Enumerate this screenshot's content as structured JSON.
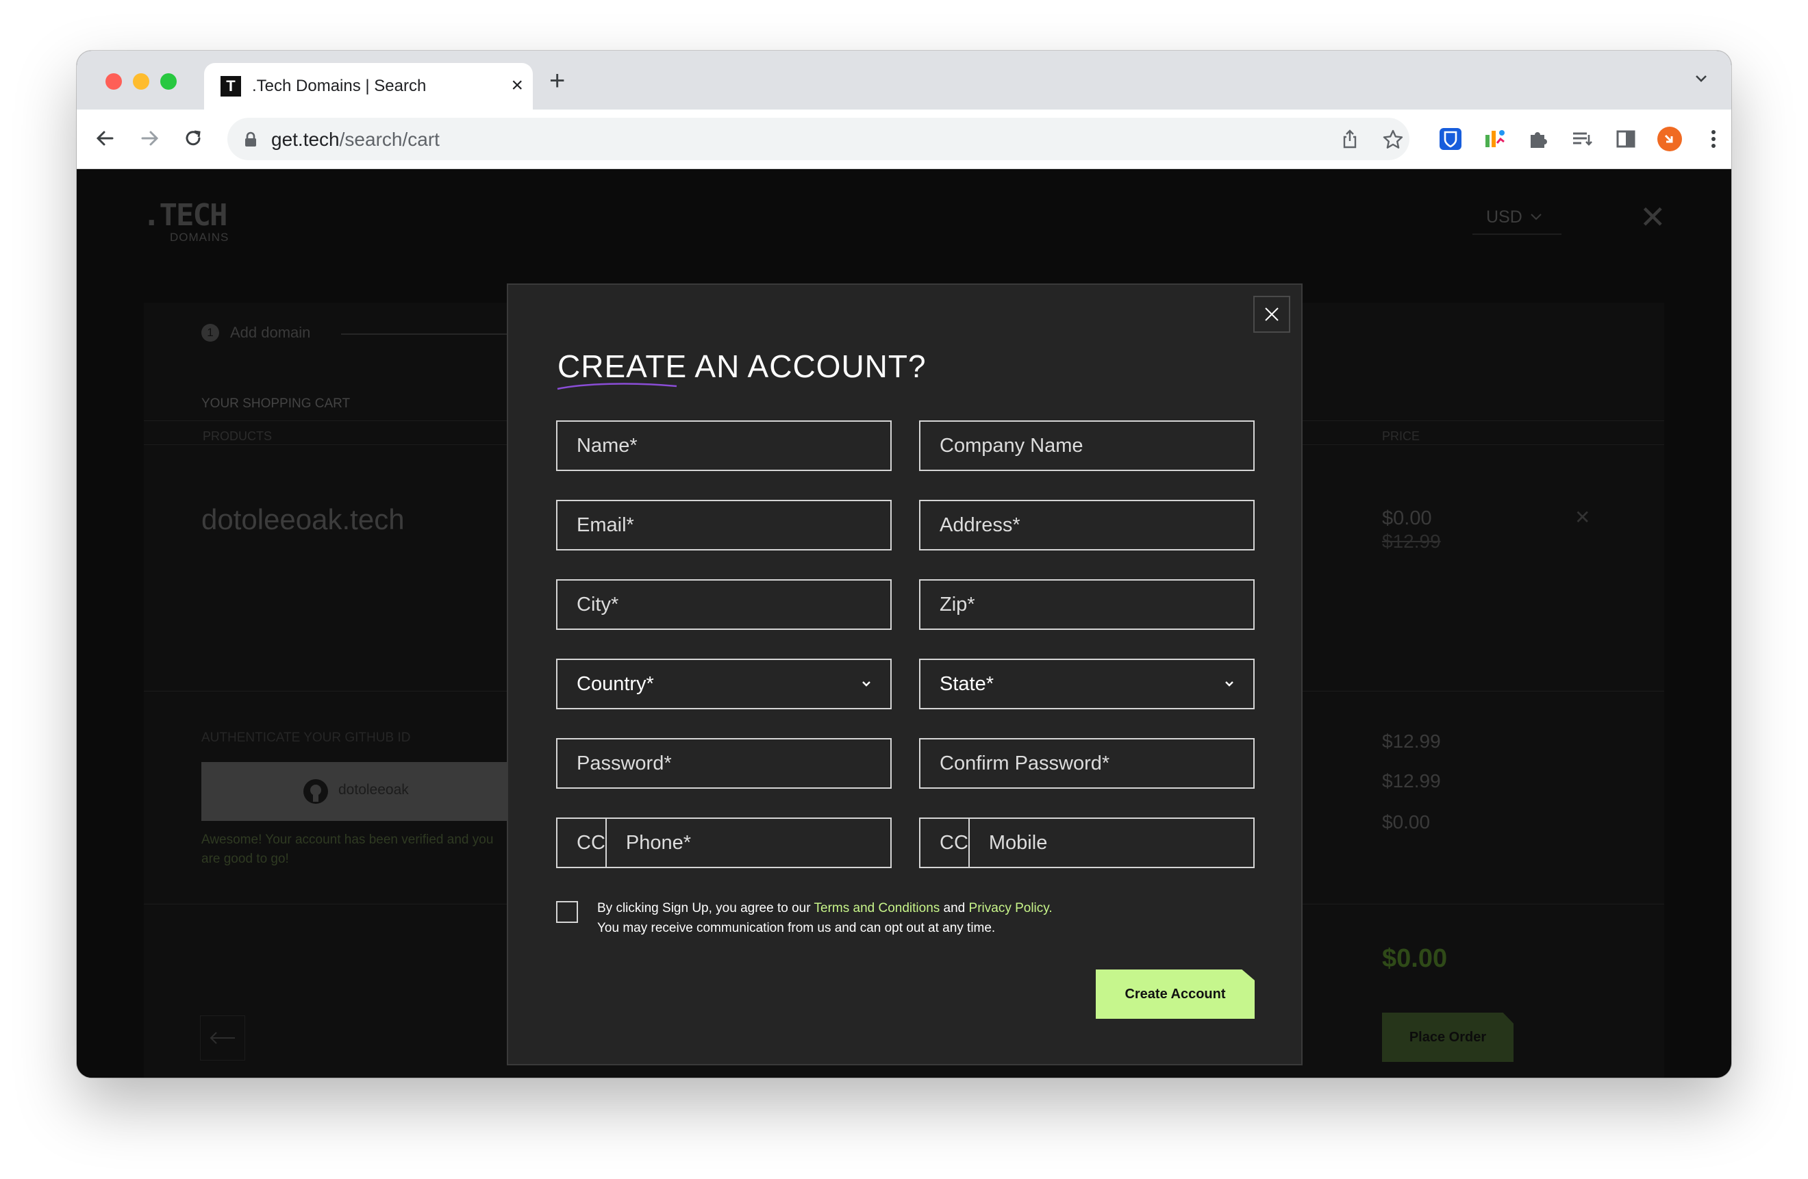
{
  "browser": {
    "tab_title": ".Tech Domains | Search",
    "favicon_text": "T",
    "url_host": "get.tech",
    "url_path": "/search/cart",
    "profile_color": "#f06a22"
  },
  "site": {
    "logo_main": ".TECH",
    "logo_sub": "DOMAINS",
    "currency": "USD",
    "step_number": "1",
    "step_label": "Add domain",
    "cart_heading": "YOUR SHOPPING CART",
    "products_col": "PRODUCTS",
    "price_col": "PRICE",
    "domain_name": "dotoleeoak.tech",
    "price_now": "$0.00",
    "price_old": "$12.99",
    "github_heading": "AUTHENTICATE YOUR GITHUB ID",
    "github_user": "dotoleeoak",
    "github_verified": "Awesome! Your account has been verified and you are good to go!",
    "subtotal_1": "$12.99",
    "subtotal_2": "$12.99",
    "subtotal_3": "$0.00",
    "total": "$0.00",
    "place_order": "Place Order"
  },
  "modal": {
    "title": "CREATE AN ACCOUNT?",
    "name_placeholder": "Name*",
    "company_placeholder": "Company Name",
    "email_placeholder": "Email*",
    "address_placeholder": "Address*",
    "city_placeholder": "City*",
    "zip_placeholder": "Zip*",
    "country_label": "Country*",
    "state_label": "State*",
    "password_placeholder": "Password*",
    "confirm_password_placeholder": "Confirm Password*",
    "phone_cc": "CC",
    "phone_placeholder": "Phone*",
    "mobile_cc": "CC",
    "mobile_placeholder": "Mobile",
    "consent_prefix": "By clicking Sign Up, you agree to our",
    "terms_link": "Terms and Conditions",
    "consent_and": "and",
    "privacy_link": "Privacy Policy.",
    "consent_line2": "You may receive communication from us and can opt out at any time.",
    "create_button": "Create Account",
    "accent_color": "#c6f68d"
  }
}
